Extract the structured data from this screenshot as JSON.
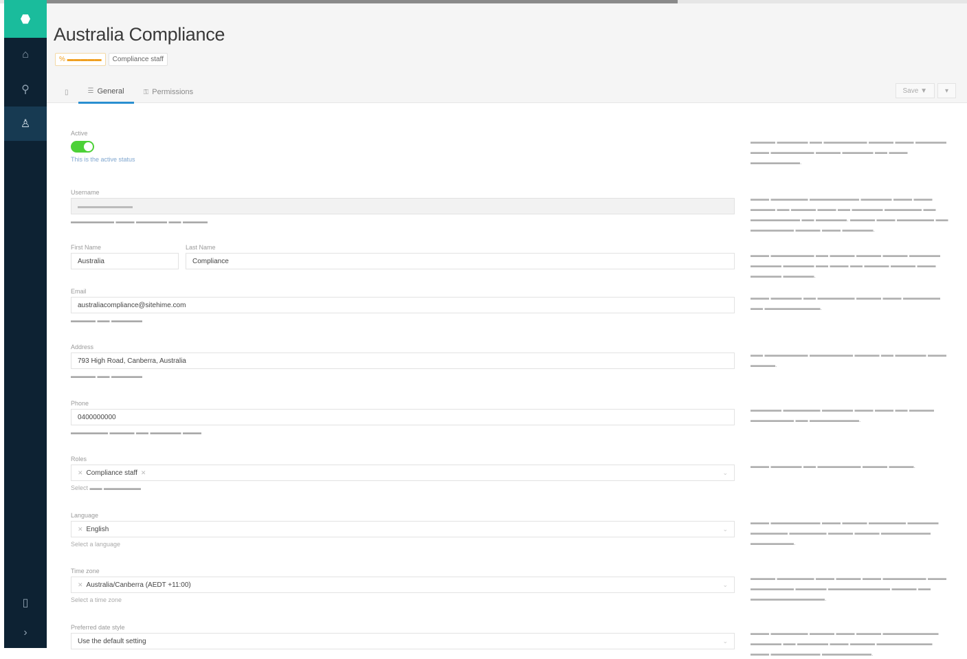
{
  "colors": {
    "sidebar": "#0d2233",
    "accent": "#1abc9c",
    "toggle_on": "#4cd137",
    "tab_underline": "#2a8fd0",
    "warning": "#f0a020"
  },
  "sidebar": {
    "logo_icon": "hexagon-logo-icon",
    "items": [
      {
        "icon": "home-icon",
        "glyph": "⌂"
      },
      {
        "icon": "search-icon",
        "glyph": "⚲"
      },
      {
        "icon": "user-icon",
        "glyph": "♙"
      }
    ],
    "bottom": [
      {
        "icon": "device-icon",
        "glyph": "▯"
      },
      {
        "icon": "expand-icon",
        "glyph": "›"
      }
    ]
  },
  "header": {
    "title": "Australia Compliance",
    "badges": [
      "% ▬▬▬▬▬",
      "Compliance staff"
    ],
    "tabs": [
      {
        "icon": "▯",
        "label": ""
      },
      {
        "icon": "☰",
        "label": "General"
      },
      {
        "icon": "⚿",
        "label": "Permissions"
      }
    ],
    "actions": [
      "Save ▼",
      "▾"
    ]
  },
  "form": {
    "active": {
      "label": "Active",
      "hint": "This is the active status"
    },
    "username": {
      "label": "Username",
      "value": "▬▬▬▬▬▬▬▬",
      "hint": "▬▬▬▬▬▬▬ ▬▬▬ ▬▬▬▬▬ ▬▬ ▬▬▬▬"
    },
    "first_name": {
      "label": "First Name",
      "value": "Australia"
    },
    "last_name": {
      "label": "Last Name",
      "value": "Compliance"
    },
    "email": {
      "label": "Email",
      "value": "australiacompliance@sitehime.com",
      "hint": "▬▬▬▬ ▬▬ ▬▬▬▬▬"
    },
    "address": {
      "label": "Address",
      "value": "793 High Road, Canberra, Australia",
      "hint": "▬▬▬▬ ▬▬ ▬▬▬▬▬"
    },
    "phone": {
      "label": "Phone",
      "value": "0400000000",
      "hint": "▬▬▬▬▬▬ ▬▬▬▬ ▬▬ ▬▬▬▬▬ ▬▬▬"
    },
    "roles": {
      "label": "Roles",
      "chip": "Compliance staff",
      "hint": "Select ▬▬ ▬▬▬▬▬▬"
    },
    "language": {
      "label": "Language",
      "chip": "English",
      "hint": "Select a language"
    },
    "timezone": {
      "label": "Time zone",
      "chip": "Australia/Canberra (AEDT +11:00)",
      "hint": "Select a time zone"
    },
    "preferred_date": {
      "label": "Preferred date style",
      "value": "Use the default setting"
    }
  },
  "descriptions": {
    "active": "▬▬▬▬ ▬▬▬▬▬ ▬▬ ▬▬▬▬▬▬▬ ▬▬▬▬ ▬▬▬ ▬▬▬▬▬ ▬▬▬ ▬▬▬▬▬▬▬ ▬▬▬▬ ▬▬▬▬▬ ▬▬ ▬▬▬ ▬▬▬▬▬▬▬▬.",
    "username": "▬▬▬ ▬▬▬▬▬▬ ▬▬▬▬▬▬▬▬ ▬▬▬▬▬ ▬▬▬ ▬▬▬ ▬▬▬▬ ▬▬ ▬▬▬▬ ▬▬▬ ▬▬ ▬▬▬▬▬ ▬▬▬▬▬▬ ▬▬ ▬▬▬▬▬▬▬▬ ▬▬ ▬▬▬▬▬. ▬▬▬▬ ▬▬▬ ▬▬▬▬▬▬ ▬▬ ▬▬▬▬▬▬▬ ▬▬▬▬ ▬▬▬ ▬▬▬▬▬.",
    "name": "▬▬▬ ▬▬▬▬▬▬▬ ▬▬ ▬▬▬▬ ▬▬▬▬ ▬▬▬▬ ▬▬▬▬▬ ▬▬▬▬▬ ▬▬▬▬▬ ▬▬ ▬▬▬ ▬▬ ▬▬▬▬ ▬▬▬▬ ▬▬▬ ▬▬▬▬▬ ▬▬▬▬▬.",
    "email": "▬▬▬ ▬▬▬▬▬ ▬▬ ▬▬▬▬▬▬ ▬▬▬▬ ▬▬▬ ▬▬▬▬▬▬ ▬▬ ▬▬▬▬▬▬▬▬▬.",
    "address": "▬▬ ▬▬▬▬▬▬▬ ▬▬▬▬▬▬▬ ▬▬▬▬ ▬▬ ▬▬▬▬▬ ▬▬▬ ▬▬▬▬.",
    "phone": "▬▬▬▬▬ ▬▬▬▬▬▬ ▬▬▬▬▬ ▬▬▬ ▬▬▬ ▬▬ ▬▬▬▬ ▬▬▬▬▬▬▬ ▬▬ ▬▬▬▬▬▬▬▬.",
    "roles": "▬▬▬ ▬▬▬▬▬ ▬▬ ▬▬▬▬▬▬▬ ▬▬▬▬ ▬▬▬▬.",
    "language": "▬▬▬ ▬▬▬▬▬▬▬▬ ▬▬▬ ▬▬▬▬ ▬▬▬▬▬▬ ▬▬▬▬▬ ▬▬▬▬▬▬ ▬▬▬▬▬▬ ▬▬▬▬ ▬▬▬▬ ▬▬▬▬▬▬▬▬ ▬▬▬▬▬▬▬.",
    "timezone": "▬▬▬▬ ▬▬▬▬▬▬ ▬▬▬ ▬▬▬▬ ▬▬▬ ▬▬▬▬▬▬▬ ▬▬▬ ▬▬▬▬▬▬▬ ▬▬▬▬▬ ▬▬▬▬▬▬▬▬▬▬ ▬▬▬▬ ▬▬ ▬▬▬▬▬▬▬▬▬▬▬▬.",
    "preferred_date": "▬▬▬ ▬▬▬▬▬▬ ▬▬▬▬ ▬▬▬ ▬▬▬▬ ▬▬▬▬▬▬▬▬▬ ▬▬▬▬▬ ▬▬ ▬▬▬▬▬ ▬▬▬ ▬▬▬▬ ▬▬▬▬▬▬▬▬▬ ▬▬▬ ▬▬▬▬▬▬▬▬ ▬▬▬▬▬▬▬▬."
  }
}
